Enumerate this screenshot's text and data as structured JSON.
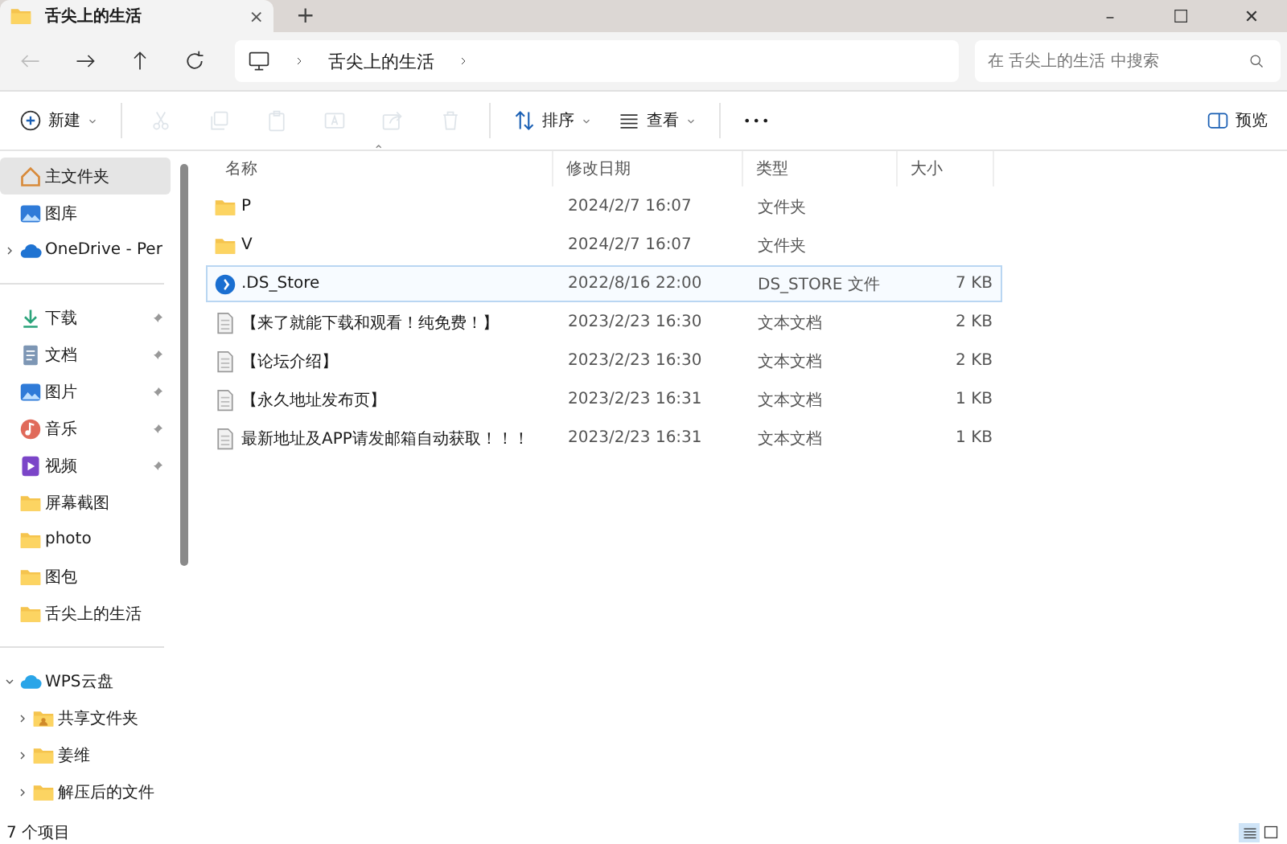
{
  "tabs": [
    {
      "title": "舌尖上的生活",
      "selected": true,
      "close": "×"
    }
  ],
  "new_tab": "+",
  "window_controls": [
    "–",
    "☐",
    "✕"
  ],
  "address": {
    "crumbs": [
      "舌尖上的生活"
    ]
  },
  "search": {
    "placeholder": "在 舌尖上的生活 中搜索"
  },
  "toolbar": [
    {
      "kind": "new",
      "label": "新建",
      "disabled": false
    },
    {
      "kind": "cut",
      "disabled": true
    },
    {
      "kind": "copy",
      "disabled": true
    },
    {
      "kind": "paste",
      "disabled": true
    },
    {
      "kind": "rename",
      "disabled": true
    },
    {
      "kind": "share",
      "disabled": true
    },
    {
      "kind": "delete",
      "disabled": true
    },
    {
      "kind": "sort",
      "label": "排序",
      "disabled": false
    },
    {
      "kind": "view",
      "label": "查看",
      "disabled": false
    },
    {
      "kind": "more",
      "label": "•••",
      "disabled": false
    }
  ],
  "preview": {
    "label": "预览"
  },
  "sidebar": {
    "groups": [
      [
        {
          "label": "主文件夹",
          "kind": "home",
          "selected": true
        },
        {
          "label": "图库",
          "kind": "gallery",
          "selected": false
        },
        {
          "label": "OneDrive - Per",
          "kind": "cloud",
          "selected": false,
          "expanded": false
        }
      ],
      [
        {
          "label": "下载",
          "kind": "download",
          "selected": false,
          "pinned": true
        },
        {
          "label": "文档",
          "kind": "document",
          "selected": false,
          "pinned": true
        },
        {
          "label": "图片",
          "kind": "gallery",
          "selected": false,
          "pinned": true
        },
        {
          "label": "音乐",
          "kind": "music",
          "selected": false,
          "pinned": true
        },
        {
          "label": "视频",
          "kind": "video",
          "selected": false,
          "pinned": true
        },
        {
          "label": "屏幕截图",
          "kind": "folder",
          "selected": false,
          "pinned": false
        },
        {
          "label": "photo",
          "kind": "folder",
          "selected": false,
          "pinned": false
        },
        {
          "label": "图包",
          "kind": "folder",
          "selected": false,
          "pinned": false
        },
        {
          "label": "舌尖上的生活",
          "kind": "folder",
          "selected": false,
          "pinned": false
        }
      ],
      [
        {
          "label": "WPS云盘",
          "kind": "wps",
          "selected": false,
          "expanded": true,
          "children": [
            {
              "label": "共享文件夹",
              "kind": "shared",
              "selected": false,
              "expanded": false
            },
            {
              "label": "姜维",
              "kind": "folder",
              "selected": false,
              "expanded": false
            },
            {
              "label": "解压后的文件",
              "kind": "folder",
              "selected": false,
              "expanded": false
            }
          ]
        }
      ]
    ]
  },
  "table": {
    "columns": [
      "名称",
      "修改日期",
      "类型",
      "大小"
    ],
    "sort_mark": "⌃",
    "rows": [
      {
        "kind": "folder",
        "name": "P",
        "date": "2024/2/7 16:07",
        "type": "文件夹",
        "size": "",
        "selected": false
      },
      {
        "kind": "folder",
        "name": "V",
        "date": "2024/2/7 16:07",
        "type": "文件夹",
        "size": "",
        "selected": false
      },
      {
        "kind": "app",
        "name": ".DS_Store",
        "date": "2022/8/16 22:00",
        "type": "DS_STORE 文件",
        "size": "7 KB",
        "selected": true
      },
      {
        "kind": "text",
        "name": "【来了就能下载和观看！纯免费！】",
        "date": "2023/2/23 16:30",
        "type": "文本文档",
        "size": "2 KB",
        "selected": false
      },
      {
        "kind": "text",
        "name": "【论坛介绍】",
        "date": "2023/2/23 16:30",
        "type": "文本文档",
        "size": "2 KB",
        "selected": false
      },
      {
        "kind": "text",
        "name": "【永久地址发布页】",
        "date": "2023/2/23 16:31",
        "type": "文本文档",
        "size": "1 KB",
        "selected": false
      },
      {
        "kind": "text",
        "name": "最新地址及APP请发邮箱自动获取！！！",
        "date": "2023/2/23 16:31",
        "type": "文本文档",
        "size": "1 KB",
        "selected": false
      }
    ]
  },
  "status_bar": {
    "count": "7 个项目",
    "views": [
      {
        "kind": "details",
        "selected": true
      },
      {
        "kind": "tiles",
        "selected": false
      }
    ]
  }
}
